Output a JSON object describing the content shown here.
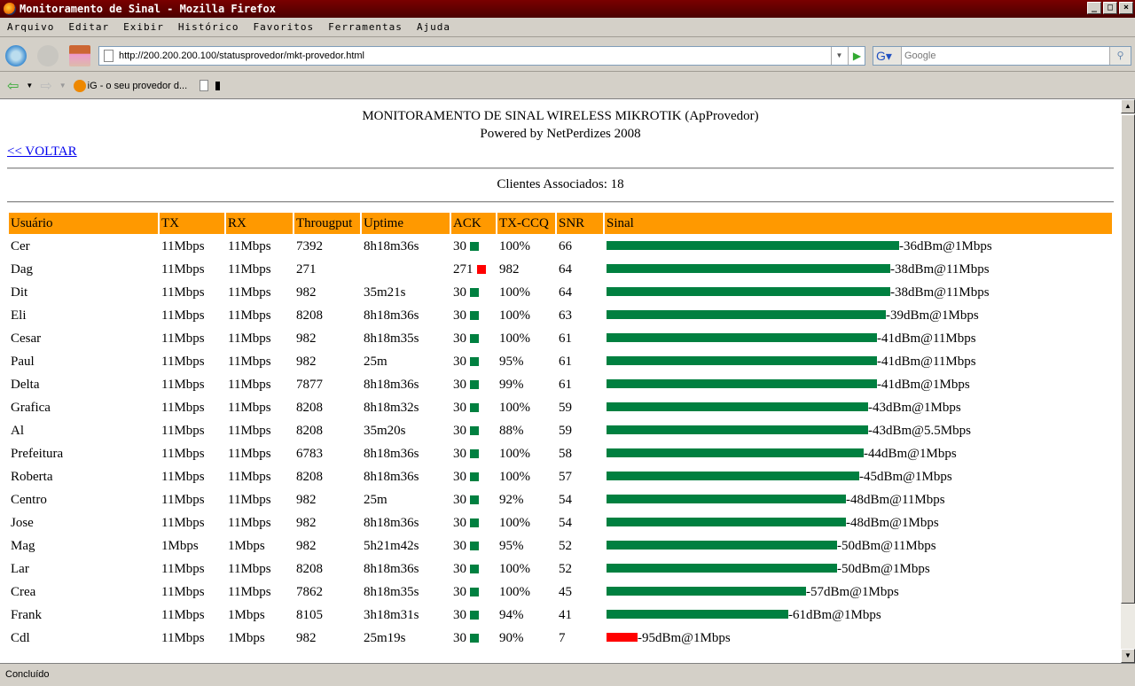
{
  "window": {
    "title": "Monitoramento de Sinal - Mozilla Firefox"
  },
  "menu": [
    "Arquivo",
    "Editar",
    "Exibir",
    "Histórico",
    "Favoritos",
    "Ferramentas",
    "Ajuda"
  ],
  "nav": {
    "url": "http://200.200.200.100/statusprovedor/mkt-provedor.html",
    "search_placeholder": "Google"
  },
  "bookmarks": {
    "item1": "iG - o seu provedor d..."
  },
  "page": {
    "title": "MONITORAMENTO DE SINAL WIRELESS MIKROTIK (ApProvedor)",
    "subtitle": "Powered by NetPerdizes 2008",
    "back_link": "<< VOLTAR",
    "clients": "Clientes Associados: 18"
  },
  "table": {
    "headers": [
      "Usuário",
      "TX",
      "RX",
      "Througput",
      "Uptime",
      "ACK",
      "TX-CCQ",
      "SNR",
      "Sinal"
    ],
    "rows": [
      {
        "user": "Cer",
        "tx": "11Mbps",
        "rx": "11Mbps",
        "thr": "7392",
        "uptime": "8h18m36s",
        "ack": "30",
        "ack_ok": true,
        "ccq": "100%",
        "snr": "66",
        "dbm": -36,
        "signal": "-36dBm@1Mbps"
      },
      {
        "user": "Dag",
        "tx": "11Mbps",
        "rx": "11Mbps",
        "thr": "271",
        "uptime": "",
        "ack": "271",
        "ack_ok": false,
        "ccq": "982",
        "snr": "64",
        "dbm": -38,
        "signal": "-38dBm@11Mbps"
      },
      {
        "user": "Dit",
        "tx": "11Mbps",
        "rx": "11Mbps",
        "thr": "982",
        "uptime": "35m21s",
        "ack": "30",
        "ack_ok": true,
        "ccq": "100%",
        "snr": "64",
        "dbm": -38,
        "signal": "-38dBm@11Mbps"
      },
      {
        "user": "Eli",
        "tx": "11Mbps",
        "rx": "11Mbps",
        "thr": "8208",
        "uptime": "8h18m36s",
        "ack": "30",
        "ack_ok": true,
        "ccq": "100%",
        "snr": "63",
        "dbm": -39,
        "signal": "-39dBm@1Mbps"
      },
      {
        "user": "Cesar",
        "tx": "11Mbps",
        "rx": "11Mbps",
        "thr": "982",
        "uptime": "8h18m35s",
        "ack": "30",
        "ack_ok": true,
        "ccq": "100%",
        "snr": "61",
        "dbm": -41,
        "signal": "-41dBm@11Mbps"
      },
      {
        "user": "Paul",
        "tx": "11Mbps",
        "rx": "11Mbps",
        "thr": "982",
        "uptime": "25m",
        "ack": "30",
        "ack_ok": true,
        "ccq": "95%",
        "snr": "61",
        "dbm": -41,
        "signal": "-41dBm@11Mbps"
      },
      {
        "user": "Delta",
        "tx": "11Mbps",
        "rx": "11Mbps",
        "thr": "7877",
        "uptime": "8h18m36s",
        "ack": "30",
        "ack_ok": true,
        "ccq": "99%",
        "snr": "61",
        "dbm": -41,
        "signal": "-41dBm@1Mbps"
      },
      {
        "user": "Grafica",
        "tx": "11Mbps",
        "rx": "11Mbps",
        "thr": "8208",
        "uptime": "8h18m32s",
        "ack": "30",
        "ack_ok": true,
        "ccq": "100%",
        "snr": "59",
        "dbm": -43,
        "signal": "-43dBm@1Mbps"
      },
      {
        "user": "Al",
        "tx": "11Mbps",
        "rx": "11Mbps",
        "thr": "8208",
        "uptime": "35m20s",
        "ack": "30",
        "ack_ok": true,
        "ccq": "88%",
        "snr": "59",
        "dbm": -43,
        "signal": "-43dBm@5.5Mbps"
      },
      {
        "user": "Prefeitura",
        "tx": "11Mbps",
        "rx": "11Mbps",
        "thr": "6783",
        "uptime": "8h18m36s",
        "ack": "30",
        "ack_ok": true,
        "ccq": "100%",
        "snr": "58",
        "dbm": -44,
        "signal": "-44dBm@1Mbps"
      },
      {
        "user": "Roberta",
        "tx": "11Mbps",
        "rx": "11Mbps",
        "thr": "8208",
        "uptime": "8h18m36s",
        "ack": "30",
        "ack_ok": true,
        "ccq": "100%",
        "snr": "57",
        "dbm": -45,
        "signal": "-45dBm@1Mbps"
      },
      {
        "user": "Centro",
        "tx": "11Mbps",
        "rx": "11Mbps",
        "thr": "982",
        "uptime": "25m",
        "ack": "30",
        "ack_ok": true,
        "ccq": "92%",
        "snr": "54",
        "dbm": -48,
        "signal": "-48dBm@11Mbps"
      },
      {
        "user": "Jose",
        "tx": "11Mbps",
        "rx": "11Mbps",
        "thr": "982",
        "uptime": "8h18m36s",
        "ack": "30",
        "ack_ok": true,
        "ccq": "100%",
        "snr": "54",
        "dbm": -48,
        "signal": "-48dBm@1Mbps"
      },
      {
        "user": "Mag",
        "tx": "1Mbps",
        "rx": "1Mbps",
        "thr": "982",
        "uptime": "5h21m42s",
        "ack": "30",
        "ack_ok": true,
        "ccq": "95%",
        "snr": "52",
        "dbm": -50,
        "signal": "-50dBm@11Mbps"
      },
      {
        "user": "Lar",
        "tx": "11Mbps",
        "rx": "11Mbps",
        "thr": "8208",
        "uptime": "8h18m36s",
        "ack": "30",
        "ack_ok": true,
        "ccq": "100%",
        "snr": "52",
        "dbm": -50,
        "signal": "-50dBm@1Mbps"
      },
      {
        "user": "Crea",
        "tx": "11Mbps",
        "rx": "11Mbps",
        "thr": "7862",
        "uptime": "8h18m35s",
        "ack": "30",
        "ack_ok": true,
        "ccq": "100%",
        "snr": "45",
        "dbm": -57,
        "signal": "-57dBm@1Mbps"
      },
      {
        "user": "Frank",
        "tx": "11Mbps",
        "rx": "1Mbps",
        "thr": "8105",
        "uptime": "3h18m31s",
        "ack": "30",
        "ack_ok": true,
        "ccq": "94%",
        "snr": "41",
        "dbm": -61,
        "signal": "-61dBm@1Mbps"
      },
      {
        "user": "Cdl",
        "tx": "11Mbps",
        "rx": "1Mbps",
        "thr": "982",
        "uptime": "25m19s",
        "ack": "30",
        "ack_ok": true,
        "ccq": "90%",
        "snr": "7",
        "dbm": -95,
        "signal": "-95dBm@1Mbps"
      }
    ]
  },
  "colors": {
    "header": "#ff9900",
    "good": "#008040",
    "bad": "#ff0000"
  },
  "status": "Concluído"
}
